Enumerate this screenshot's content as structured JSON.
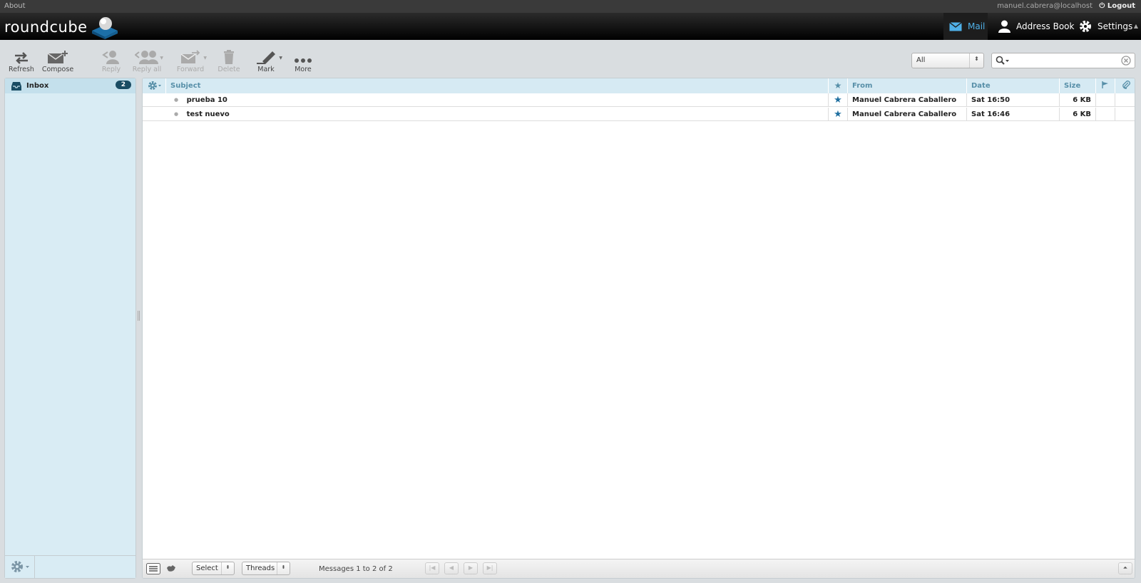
{
  "topline": {
    "about": "About",
    "username": "manuel.cabrera@localhost",
    "logout": "Logout"
  },
  "header": {
    "logo_text": "roundcube",
    "tasks": [
      {
        "label": "Mail",
        "icon": "mail-icon",
        "active": true
      },
      {
        "label": "Address Book",
        "icon": "user-icon"
      },
      {
        "label": "Settings",
        "icon": "gear-icon"
      }
    ]
  },
  "toolbar": {
    "refresh": "Refresh",
    "compose": "Compose",
    "reply": "Reply",
    "reply_all": "Reply all",
    "forward": "Forward",
    "delete": "Delete",
    "mark": "Mark",
    "more": "More"
  },
  "search": {
    "filter_value": "All",
    "query": ""
  },
  "folders": [
    {
      "name": "Inbox",
      "unread": "2"
    }
  ],
  "messagelist": {
    "columns": {
      "subject": "Subject",
      "from": "From",
      "date": "Date",
      "size": "Size"
    },
    "rows": [
      {
        "subject": "prueba 10",
        "from": "Manuel Cabrera Caballero",
        "date": "Sat 16:50",
        "size": "6 KB"
      },
      {
        "subject": "test nuevo",
        "from": "Manuel Cabrera Caballero",
        "date": "Sat 16:46",
        "size": "6 KB"
      }
    ]
  },
  "footer": {
    "select": "Select",
    "threads": "Threads",
    "count": "Messages 1 to 2 of 2"
  },
  "colors": {
    "accent": "#4fb0e8",
    "unread_badge": "#1a4c63",
    "flag_star": "#1f6fa0"
  }
}
